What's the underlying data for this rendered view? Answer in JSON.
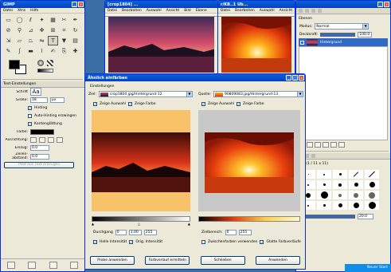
{
  "toolbox": {
    "title": "GIMP",
    "menus": [
      "Datei",
      "Xtns",
      "Hilfe"
    ],
    "tools": [
      "rect-select",
      "ellipse-select",
      "free-select",
      "fuzzy-select",
      "color-select",
      "scissors",
      "paths",
      "color-picker",
      "zoom",
      "measure",
      "move",
      "align",
      "crop",
      "rotate",
      "scale",
      "shear",
      "perspective",
      "flip",
      "text",
      "bucket-fill",
      "blend",
      "pencil",
      "paintbrush",
      "eraser",
      "airbrush",
      "ink",
      "clone",
      "heal",
      "perspective-clone",
      "blur",
      "smudge",
      "dodge"
    ],
    "text_options": {
      "tab": "Text-Einstellungen",
      "font_label": "Schrift",
      "font_value": "Aa",
      "size_label": "Größe:",
      "size_value": "18",
      "unit_value": "px",
      "hinting_label": "Hinting",
      "autohint_label": "Auto-Hinting erzwingen",
      "antialias_label": "Kantenglättung",
      "color_label": "Farbe:",
      "justify_label": "Ausrichtung:",
      "indent_label": "Einzug:",
      "indent_value": "0.0",
      "line_spacing_label": "Zeilen-\nabstand:",
      "line_spacing_value": "0.0",
      "path_button": "Pfad aus Text erzeugen"
    }
  },
  "image1": {
    "title": "[crop1804] ...",
    "menus": [
      "Datei",
      "Bearbeiten",
      "Auswahl",
      "Ansicht",
      "Bild",
      "Ebene"
    ]
  },
  "image2": {
    "title": "r/KB..1 Ub...",
    "menus": [
      "Datei",
      "Bearbeiten",
      "Auswahl",
      "Ansicht",
      "Bild",
      "Ebene"
    ]
  },
  "dock": {
    "layers_tab": "Ebenen",
    "mode_label": "Modus:",
    "mode_value": "Normal",
    "opacity_label": "Deckkraft:",
    "opacity_value": "100.0",
    "layer_name": "Hintergrund",
    "brushes_tab": "1 (1 / 11 x 11)",
    "spacing_value": "20.0"
  },
  "dialog": {
    "title": "Ähnlich einfärben",
    "section": "Einstellungen",
    "target_label": "Ziel:",
    "target_value": "crop1804.jpg/Hintergrund-12",
    "source_label": "Quelle:",
    "source_value": "90809083.jpg/Hintergrund-13",
    "show_selection_left": "Zeige Auswahl",
    "show_color_left": "Zeige Farbe",
    "show_selection_right": "Zeige Auswahl",
    "show_color_right": "Zeige Farbe",
    "left_levels_label": "Durchgang",
    "left_low": "0",
    "left_gamma": "1.00",
    "left_high": "255",
    "right_levels_label": "Zielbereich:",
    "right_low": "0",
    "right_high": "255",
    "keep_intensity": "Helle Intensität",
    "original_intensity": "Orig. Intensität",
    "use_subcolors": "Zwischenfarben verwenden",
    "smooth_colors": "Glatte Farbverläufe",
    "btn_apply_sample": "Probe anwenden",
    "btn_get_sample": "Farbverlauf ermitteln",
    "btn_close": "Schließen",
    "btn_apply": "Anwenden"
  },
  "tray": {
    "text": "Neuer Start"
  }
}
